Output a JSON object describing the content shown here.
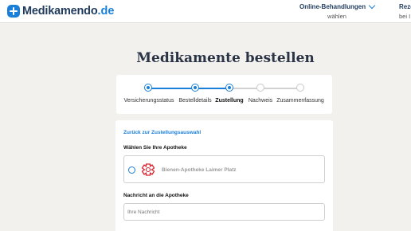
{
  "header": {
    "logo_name": "Medikamendo",
    "logo_tld": ".de",
    "nav": [
      {
        "title": "Online-Behandlungen",
        "subtitle": "wählen",
        "icon": "chevron-down-icon"
      },
      {
        "title": "Reze",
        "subtitle": "bei I"
      }
    ]
  },
  "page_title": "Medikamente bestellen",
  "stepper": {
    "steps": [
      {
        "label": "Versicherungsstatus",
        "state": "done"
      },
      {
        "label": "Bestelldetails",
        "state": "done"
      },
      {
        "label": "Zustellung",
        "state": "active"
      },
      {
        "label": "Nachweis",
        "state": "todo"
      },
      {
        "label": "Zusammenfassung",
        "state": "todo"
      }
    ]
  },
  "form": {
    "back_link": "Zurück zur Zustellungsauswahl",
    "pharmacy_heading": "Wählen Sie Ihre Apotheke",
    "pharmacy_option": {
      "name": "Bienen-Apotheke Laimer Platz",
      "icon": "pharmacy-logo-icon"
    },
    "message_heading": "Nachricht an die Apotheke",
    "message_placeholder": "Ihre Nachricht",
    "message_value": ""
  },
  "colors": {
    "accent": "#1a7fd8",
    "brand_dark": "#1f3a5c",
    "pharmacy_red": "#d9232d",
    "background": "#f3f1ee"
  }
}
